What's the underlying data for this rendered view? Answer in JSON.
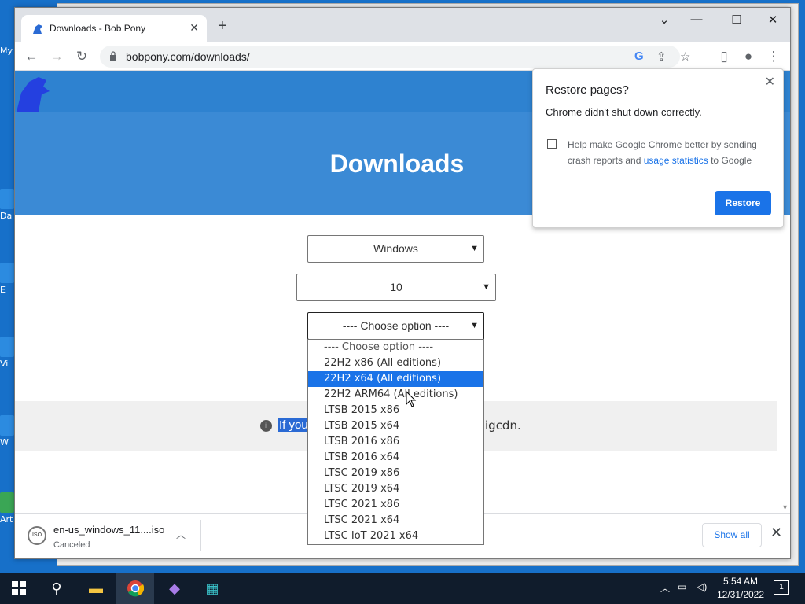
{
  "desktop": {
    "icons": [
      "My",
      "Da",
      "E",
      "Vi",
      "W",
      "Art"
    ]
  },
  "tab": {
    "title": "Downloads - Bob Pony",
    "close": "✕"
  },
  "window_controls": {
    "minimize": "—",
    "maximize": "☐",
    "close": "✕",
    "tabsearch": "⌄"
  },
  "toolbar": {
    "back": "←",
    "forward": "→",
    "reload": "↻",
    "url": "bobpony.com/downloads/"
  },
  "page": {
    "heading": "Downloads",
    "select_os": "Windows",
    "select_version": "10",
    "select_option": "---- Choose option ----",
    "notice_highlight": "If you",
    "notice_tail": "igcdn."
  },
  "dropdown": {
    "options": [
      "---- Choose option ----",
      "22H2 x86 (All editions)",
      "22H2 x64 (All editions)",
      "22H2 ARM64 (All editions)",
      "LTSB 2015 x86",
      "LTSB 2015 x64",
      "LTSB 2016 x86",
      "LTSB 2016 x64",
      "LTSC 2019 x86",
      "LTSC 2019 x64",
      "LTSC 2021 x86",
      "LTSC 2021 x64",
      "LTSC IoT 2021 x64"
    ],
    "highlighted_index": 2
  },
  "restore": {
    "title": "Restore pages?",
    "subtitle": "Chrome didn't shut down correctly.",
    "checkbox_text_before": "Help make Google Chrome better by sending crash reports and ",
    "checkbox_link": "usage statistics",
    "checkbox_text_after": " to Google",
    "button": "Restore"
  },
  "download_shelf": {
    "filename": "en-us_windows_11....iso",
    "status": "Canceled",
    "file_icon_label": "ISO",
    "show_all": "Show all"
  },
  "taskbar": {
    "time": "5:54 AM",
    "date": "12/31/2022",
    "notification_count": "1"
  }
}
